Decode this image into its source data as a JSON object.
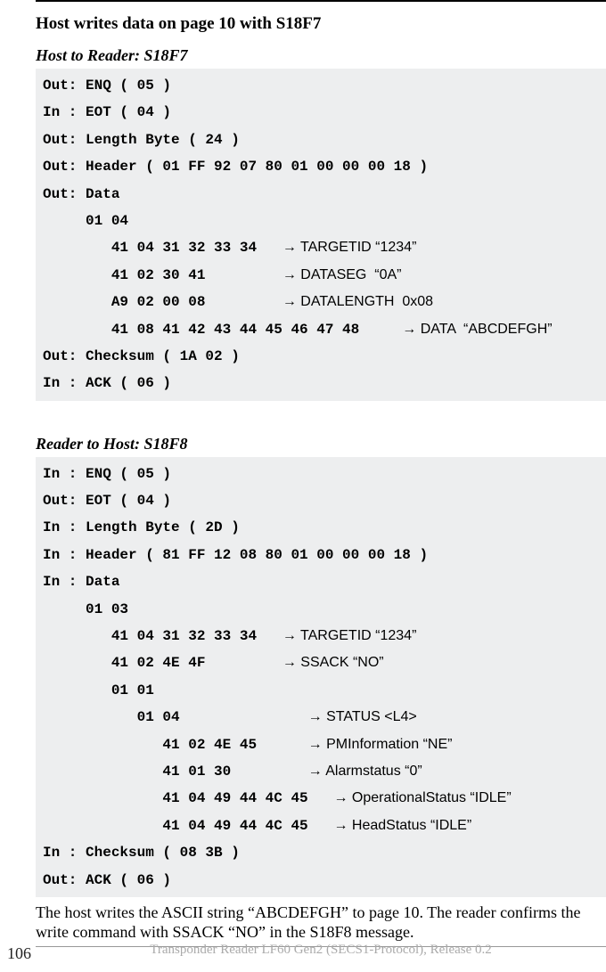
{
  "section_title": "Host writes data on page 10 with S18F7",
  "block1": {
    "title": "Host to Reader: S18F7",
    "lines": [
      {
        "text": "Out: ENQ ( 05 )",
        "annot": ""
      },
      {
        "text": "In : EOT ( 04 )",
        "annot": ""
      },
      {
        "text": "Out: Length Byte ( 24 )",
        "annot": ""
      },
      {
        "text": "Out: Header ( 01 FF 92 07 80 01 00 00 00 18 )",
        "annot": ""
      },
      {
        "text": "Out: Data",
        "annot": ""
      },
      {
        "text": "     01 04",
        "annot": ""
      },
      {
        "text": "        41 04 31 32 33 34   ",
        "annot": "→ TARGETID “1234”"
      },
      {
        "text": "        41 02 30 41         ",
        "annot": "→ DATASEG  “0A”"
      },
      {
        "text": "        A9 02 00 08         ",
        "annot": "→ DATALENGTH  0x08"
      },
      {
        "text": "        41 08 41 42 43 44 45 46 47 48     ",
        "annot": "→ DATA  “ABCDEFGH”"
      },
      {
        "text": "Out: Checksum ( 1A 02 )",
        "annot": ""
      },
      {
        "text": "In : ACK ( 06 )",
        "annot": ""
      }
    ]
  },
  "block2": {
    "title": "Reader to Host: S18F8",
    "lines": [
      {
        "text": "In : ENQ ( 05 )",
        "annot": ""
      },
      {
        "text": "Out: EOT ( 04 )",
        "annot": ""
      },
      {
        "text": "In : Length Byte ( 2D )",
        "annot": ""
      },
      {
        "text": "In : Header ( 81 FF 12 08 80 01 00 00 00 18 )",
        "annot": ""
      },
      {
        "text": "In : Data",
        "annot": ""
      },
      {
        "text": "     01 03",
        "annot": ""
      },
      {
        "text": "        41 04 31 32 33 34   ",
        "annot": "→ TARGETID “1234”"
      },
      {
        "text": "        41 02 4E 4F         ",
        "annot": "→ SSACK “NO”"
      },
      {
        "text": "        01 01",
        "annot": ""
      },
      {
        "text": "           01 04               ",
        "annot": "→ STATUS <L4>"
      },
      {
        "text": "              41 02 4E 45      ",
        "annot": "→ PMInformation “NE”"
      },
      {
        "text": "              41 01 30         ",
        "annot": "→ Alarmstatus “0”"
      },
      {
        "text": "              41 04 49 44 4C 45   ",
        "annot": "→ OperationalStatus “IDLE”"
      },
      {
        "text": "              41 04 49 44 4C 45   ",
        "annot": "→ HeadStatus “IDLE”"
      },
      {
        "text": "In : Checksum ( 08 3B )",
        "annot": ""
      },
      {
        "text": "Out: ACK ( 06 )",
        "annot": ""
      }
    ]
  },
  "body_text": "The host writes the ASCII string “ABCDEFGH” to page 10. The reader confirms the write command with SSACK “NO” in the S18F8 message.",
  "footer": {
    "page_num": "106",
    "text": "Transponder Reader LF60 Gen2 (SECS1-Protocol), Release 0.2"
  }
}
